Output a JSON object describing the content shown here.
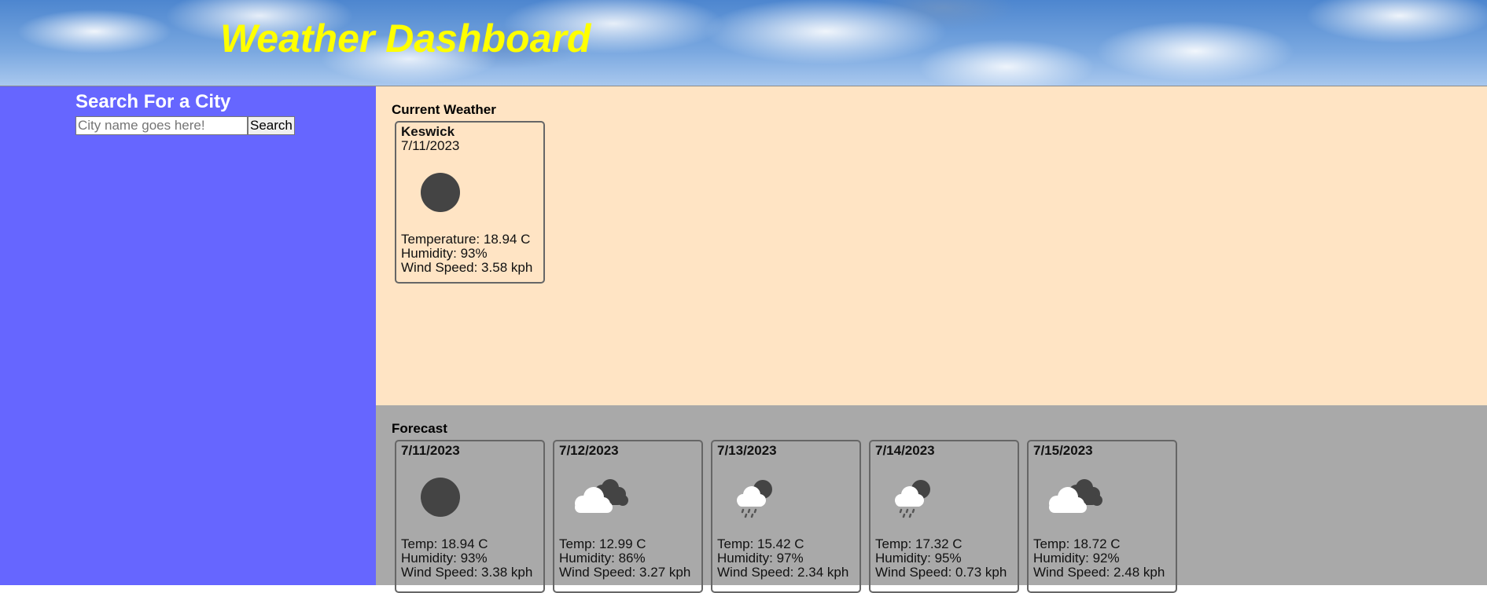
{
  "header": {
    "title": "Weather Dashboard"
  },
  "sidebar": {
    "title": "Search For a City",
    "search_placeholder": "City name goes here!",
    "search_button": "Search"
  },
  "current": {
    "heading": "Current Weather",
    "city": "Keswick",
    "date": "7/11/2023",
    "icon": "clear-moon-icon",
    "temperature": "Temperature: 18.94 C",
    "humidity": "Humidity: 93%",
    "wind": "Wind Speed: 3.58 kph"
  },
  "forecast": {
    "heading": "Forecast",
    "days": [
      {
        "date": "7/11/2023",
        "icon": "clear-moon-icon",
        "temp": "Temp: 18.94 C",
        "humidity": "Humidity: 93%",
        "wind": "Wind Speed: 3.38 kph"
      },
      {
        "date": "7/12/2023",
        "icon": "broken-clouds-icon",
        "temp": "Temp: 12.99 C",
        "humidity": "Humidity: 86%",
        "wind": "Wind Speed: 3.27 kph"
      },
      {
        "date": "7/13/2023",
        "icon": "rain-icon",
        "temp": "Temp: 15.42 C",
        "humidity": "Humidity: 97%",
        "wind": "Wind Speed: 2.34 kph"
      },
      {
        "date": "7/14/2023",
        "icon": "rain-icon",
        "temp": "Temp: 17.32 C",
        "humidity": "Humidity: 95%",
        "wind": "Wind Speed: 0.73 kph"
      },
      {
        "date": "7/15/2023",
        "icon": "broken-clouds-icon",
        "temp": "Temp: 18.72 C",
        "humidity": "Humidity: 92%",
        "wind": "Wind Speed: 2.48 kph"
      }
    ]
  },
  "colors": {
    "title": "#ffff00",
    "sidebar": "#6666ff",
    "current_bg": "#ffe4c4",
    "forecast_bg": "#a9a9a9",
    "card_border": "#666666"
  }
}
